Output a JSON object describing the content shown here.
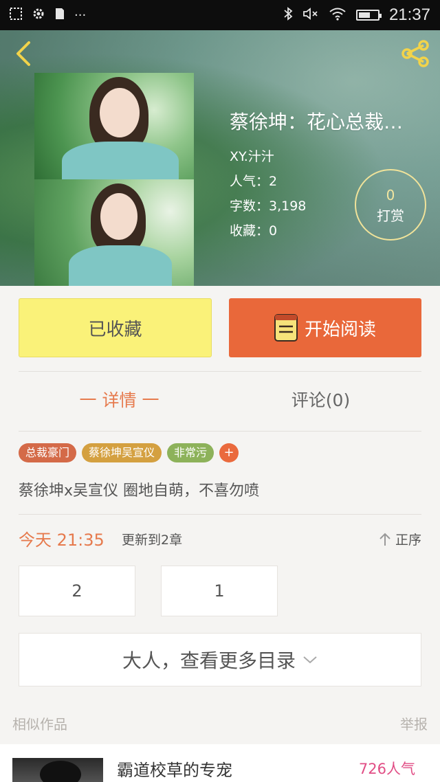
{
  "status_bar": {
    "time": "21:37",
    "left_icons": [
      "screenshot-icon",
      "gear-icon",
      "sim-icon",
      "more-dots-icon"
    ],
    "right_icons": [
      "bluetooth-icon",
      "mute-icon",
      "wifi-icon",
      "battery-icon"
    ]
  },
  "book": {
    "title": "蔡徐坤：花心总裁…",
    "author": "XY.汁汁",
    "popularity": "人气：2",
    "word_count": "字数：3,198",
    "favorites": "收藏：0"
  },
  "reward": {
    "count": "0",
    "label": "打赏"
  },
  "actions": {
    "collected_label": "已收藏",
    "read_label": "开始阅读"
  },
  "tabs": {
    "detail": "一 详情 一",
    "comments": "评论(0)"
  },
  "tags": [
    {
      "label": "总裁豪门",
      "color": "#d46a48"
    },
    {
      "label": "蔡徐坤吴宣仪",
      "color": "#d4a040"
    },
    {
      "label": "非常污",
      "color": "#8db25a"
    }
  ],
  "tag_add": "+",
  "description": "蔡徐坤x吴宣仪  圈地自萌，不喜勿喷",
  "update": {
    "today": "今天 21:35",
    "text": "更新到2章",
    "sort": "正序"
  },
  "chapters": [
    "2",
    "1"
  ],
  "more_label": "大人，查看更多目录",
  "similar": {
    "section_label": "相似作品",
    "report_label": "举报",
    "items": [
      {
        "title": "霸道校草的专宠",
        "popularity": "726人气"
      }
    ]
  },
  "colors": {
    "accent": "#e9683a",
    "collected_bg": "#faf279",
    "tab_active": "#e67a4d",
    "popularity_pink": "#e14d85"
  }
}
